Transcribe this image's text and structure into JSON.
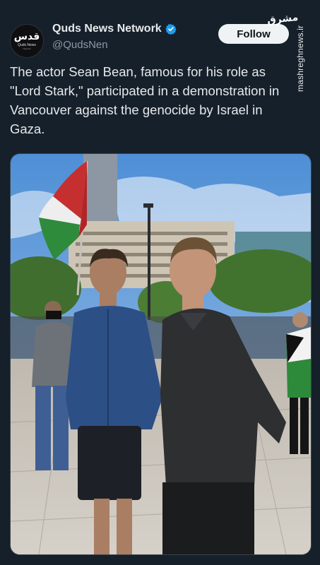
{
  "account": {
    "display_name": "Quds News Network",
    "handle": "@QudsNen",
    "avatar_logo_ar": "قدس",
    "avatar_logo_en": "Quds News",
    "avatar_logo_sub": "Network"
  },
  "follow_button": {
    "label": "Follow"
  },
  "watermark": {
    "logo_text": "مشرق",
    "url": "mashreghnews.ir"
  },
  "tweet": {
    "text": "The actor Sean Bean, famous for his role as \"Lord Stark,\" participated in a demonstration in Vancouver against the genocide by Israel in Gaza."
  },
  "colors": {
    "background": "#15202b",
    "text_primary": "#e7e9ea",
    "text_secondary": "#8b98a5",
    "verified_blue": "#1d9bf0",
    "follow_button_bg": "#eff3f4"
  },
  "media": {
    "type": "photo"
  }
}
